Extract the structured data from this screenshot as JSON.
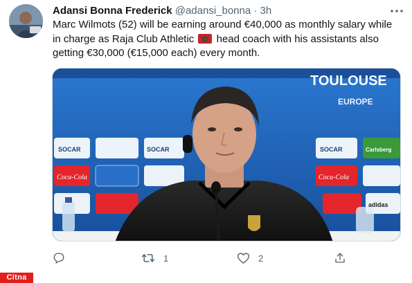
{
  "author": {
    "name": "Adansi Bonna Frederick",
    "handle": "@adansi_bonna",
    "separator": "·",
    "time": "3h"
  },
  "tweet": {
    "text_before_flag": "Marc Wilmots (52) will be earning around €40,000 as monthly salary while in charge as Raja Club Athletic ",
    "text_after_flag": " head coach with his assistants also getting €30,000 (€15,000 each) every month.",
    "flag_icon": "morocco-flag-icon"
  },
  "media": {
    "banner_text": "TOULOUSE",
    "backdrop_labels": [
      "EUROPE",
      "SOCAR",
      "Coca-Cola",
      "SOCAR",
      "Carlsberg",
      "Coca-Cola",
      "SOCAR",
      "adidas"
    ]
  },
  "actions": {
    "reply_icon": "reply-icon",
    "retweet_icon": "retweet-icon",
    "retweet_count": "1",
    "like_icon": "heart-icon",
    "like_count": "2",
    "share_icon": "share-icon"
  },
  "watermark": "Citna",
  "colors": {
    "text": "#0f1419",
    "secondary": "#536471",
    "flag_red": "#c1272d",
    "flag_star": "#006233",
    "watermark_bg": "#e0201b"
  }
}
